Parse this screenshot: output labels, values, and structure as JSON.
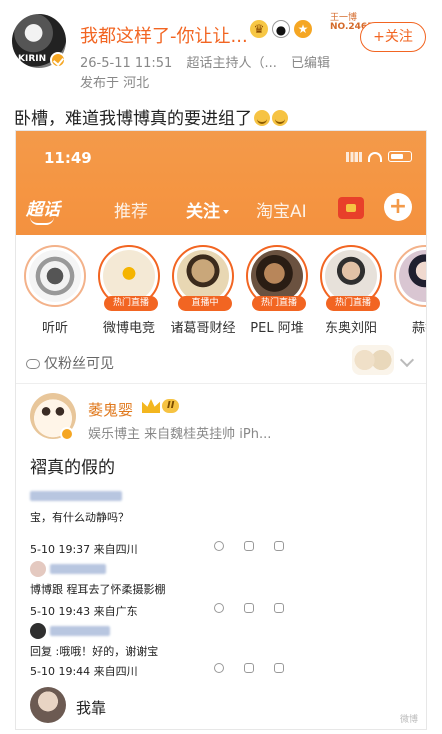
{
  "post": {
    "username": "我都这样了-你让让...",
    "fan_label_line1": "王一博",
    "fan_label_line2": "NO.2465",
    "follow_label": "+关注",
    "date": "26-5-11 11:51",
    "source": "超话主持人（...",
    "edited": "已编辑",
    "location": "发布于 河北",
    "text": "卧槽，难道我博博真的要进组了"
  },
  "screenshot": {
    "time": "11:49",
    "tabs": {
      "super": "超话",
      "recommend": "推荐",
      "follow": "关注",
      "taobao": "淘宝AI",
      "plus": "+"
    },
    "stories": [
      {
        "name": "听听",
        "badge": "",
        "color": "#ddd"
      },
      {
        "name": "微博电竞",
        "badge": "热门直播",
        "color": "#f4e9d5"
      },
      {
        "name": "诸葛哥财经",
        "badge": "直播中",
        "color": "#e8d7b3"
      },
      {
        "name": "PEL 阿堆",
        "badge": "热门直播",
        "color": "#6b5240"
      },
      {
        "name": "东奥刘阳",
        "badge": "热门直播",
        "color": "#e7e1da"
      },
      {
        "name": "蒜香",
        "badge": "",
        "color": "#d9c6d2"
      }
    ],
    "fans_only": "仅粉丝可见",
    "comment": {
      "name": "萎鬼婴",
      "level": "II",
      "meta": "娱乐博主  来自魏桂英挂帅 iPh...",
      "text": "褶真的假的"
    },
    "replies": [
      {
        "text": "宝，有什么动静吗？",
        "meta": "5-10 19:37 来自四川"
      },
      {
        "text": "博博跟  程耳去了怀柔摄影棚",
        "meta": "5-10 19:43 来自广东"
      },
      {
        "text": "回复            :哦哦！好的，谢谢宝",
        "meta": "5-10 19:44 来自四川"
      }
    ],
    "bottom_reply": "我靠",
    "watermark": "微博"
  }
}
